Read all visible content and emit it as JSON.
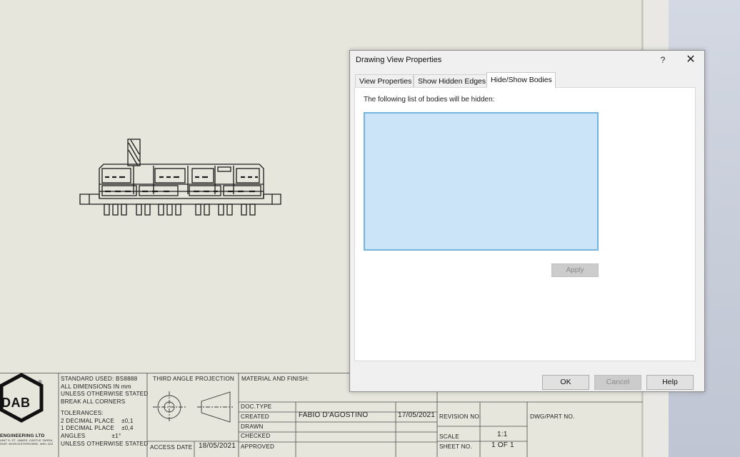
{
  "dialog": {
    "title": "Drawing View Properties",
    "help_icon": "?",
    "close_icon": "✕",
    "tabs": [
      {
        "label": "View Properties"
      },
      {
        "label": "Show Hidden Edges"
      },
      {
        "label": "Hide/Show Bodies",
        "active": true
      }
    ],
    "panel_label": "The following list of bodies will be hidden:",
    "bodies": [],
    "apply_label": "Apply",
    "ok_label": "OK",
    "cancel_label": "Cancel",
    "help_label": "Help"
  },
  "title_block": {
    "logo_text": "DAB",
    "logo_reg": "®",
    "logo_company": "ENGINEERING LTD",
    "logo_address": "UNIT 5, ST. JAMES, CASTLE TARRA",
    "logo_address2": "SHIP, WORCESTERSHIRE, WR1 2ZZ",
    "standards": [
      "STANDARD USED: BS8888",
      "ALL DIMENSIONS IN mm",
      "UNLESS OTHERWISE STATED",
      "BREAK ALL CORNERS"
    ],
    "tolerances": [
      "TOLERANCES:",
      "2 DECIMAL PLACE    ±0,1",
      "1 DECIMAL PLACE    ±0,4",
      "ANGLES               ±1°",
      "UNLESS OTHERWISE STATED"
    ],
    "projection_label": "THIRD ANGLE PROJECTION",
    "access_date_label": "ACCESS DATE",
    "access_date": "18/05/2021",
    "material_label": "MATERIAL AND FINISH:",
    "doc_type_label": "DOC.TYPE",
    "created_label": "CREATED",
    "created_by": "FABIO D'AGOSTINO",
    "created_date": "17/05/2021",
    "drawn_label": "DRAWN",
    "checked_label": "CHECKED",
    "approved_label": "APPROVED",
    "revision_label": "REVISION NO.",
    "scale_label": "SCALE",
    "scale_value": "1:1",
    "sheet_label": "SHEET NO.",
    "sheet_value": "1 OF 1",
    "dwg_label": "DWG/PART NO."
  }
}
